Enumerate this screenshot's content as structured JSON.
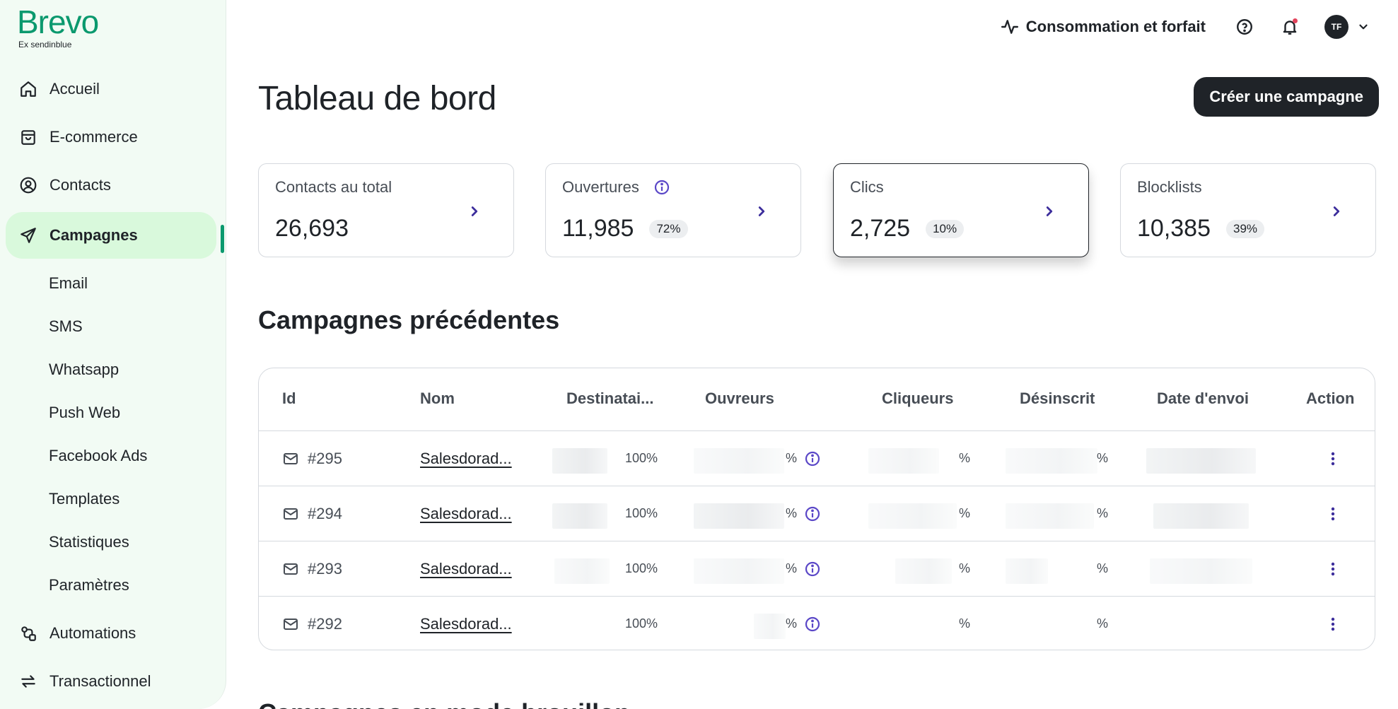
{
  "brand": {
    "name": "Brevo",
    "subtitle": "Ex sendinblue",
    "accent": "#0b996e"
  },
  "sidebar": {
    "items": [
      {
        "label": "Accueil",
        "icon": "home-icon"
      },
      {
        "label": "E-commerce",
        "icon": "shopping-bag-icon"
      },
      {
        "label": "Contacts",
        "icon": "user-circle-icon"
      },
      {
        "label": "Campagnes",
        "icon": "send-icon",
        "active": true
      }
    ],
    "subitems": [
      "Email",
      "SMS",
      "Whatsapp",
      "Push Web",
      "Facebook Ads",
      "Templates",
      "Statistiques",
      "Paramètres"
    ],
    "after": [
      {
        "label": "Automations",
        "icon": "automation-icon"
      },
      {
        "label": "Transactionnel",
        "icon": "transfer-icon"
      }
    ]
  },
  "header": {
    "usage_label": "Consommation et forfait",
    "avatar_initials": "TF"
  },
  "page": {
    "title": "Tableau de bord",
    "create_button": "Créer une campagne"
  },
  "stats": [
    {
      "label": "Contacts au total",
      "value": "26,693",
      "badge": ""
    },
    {
      "label": "Ouvertures",
      "value": "11,985",
      "badge": "72%"
    },
    {
      "label": "Clics",
      "value": "2,725",
      "badge": "10%"
    },
    {
      "label": "Blocklists",
      "value": "10,385",
      "badge": "39%"
    }
  ],
  "campaigns": {
    "title": "Campagnes précédentes",
    "columns": [
      "Id",
      "Nom",
      "Destinatai...",
      "Ouvreurs",
      "Cliqueurs",
      "Désinscrit",
      "Date d'envoi",
      "Action"
    ],
    "rows": [
      {
        "id": "#295",
        "name": "Salesdorad...",
        "recipients_pct": "100%",
        "open_pct": "%",
        "click_pct": "%",
        "unsub_pct": "%"
      },
      {
        "id": "#294",
        "name": "Salesdorad...",
        "recipients_pct": "100%",
        "open_pct": "%",
        "click_pct": "%",
        "unsub_pct": "%"
      },
      {
        "id": "#293",
        "name": "Salesdorad...",
        "recipients_pct": "100%",
        "open_pct": "%",
        "click_pct": "%",
        "unsub_pct": "%"
      },
      {
        "id": "#292",
        "name": "Salesdorad...",
        "recipients_pct": "100%",
        "open_pct": "%",
        "click_pct": "%",
        "unsub_pct": "%"
      }
    ]
  },
  "drafts": {
    "title": "Campagnes en mode brouillon"
  }
}
